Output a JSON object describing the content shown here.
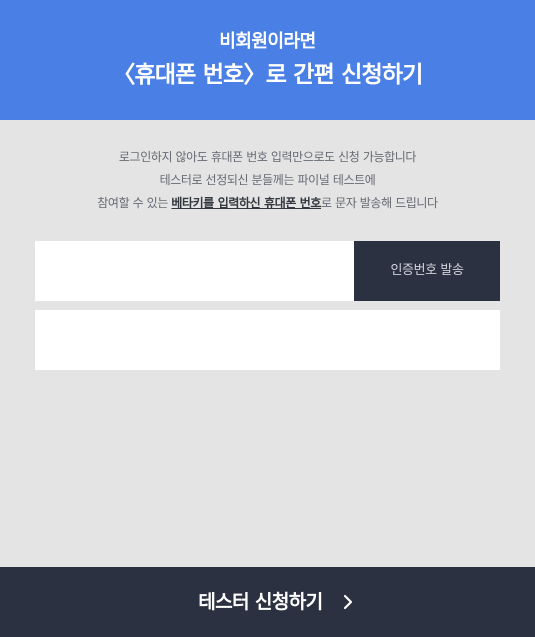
{
  "header": {
    "subtitle": "비회원이라면",
    "title": "〈휴대폰 번호〉로 간편 신청하기"
  },
  "notice": {
    "line1": "로그인하지 않아도 휴대폰 번호 입력만으로도 신청 가능합니다",
    "line2": "테스터로 선정되신 분들께는 파이널 테스트에",
    "line3_before": "참여할 수 있는 ",
    "line3_highlight": "베타키를 입력하신 휴대폰 번호",
    "line3_after": "로 문자 발송해 드립니다"
  },
  "form": {
    "phone_value": "",
    "phone_placeholder": "",
    "send_code_label": "인증번호 발송",
    "code_value": "",
    "code_placeholder": ""
  },
  "footer": {
    "submit_label": "테스터 신청하기"
  },
  "colors": {
    "header_bg": "#4a7fe6",
    "page_bg": "#e4e4e4",
    "dark_button_bg": "#2b3140"
  },
  "icons": {
    "submit_arrow": "chevron-right-icon"
  }
}
